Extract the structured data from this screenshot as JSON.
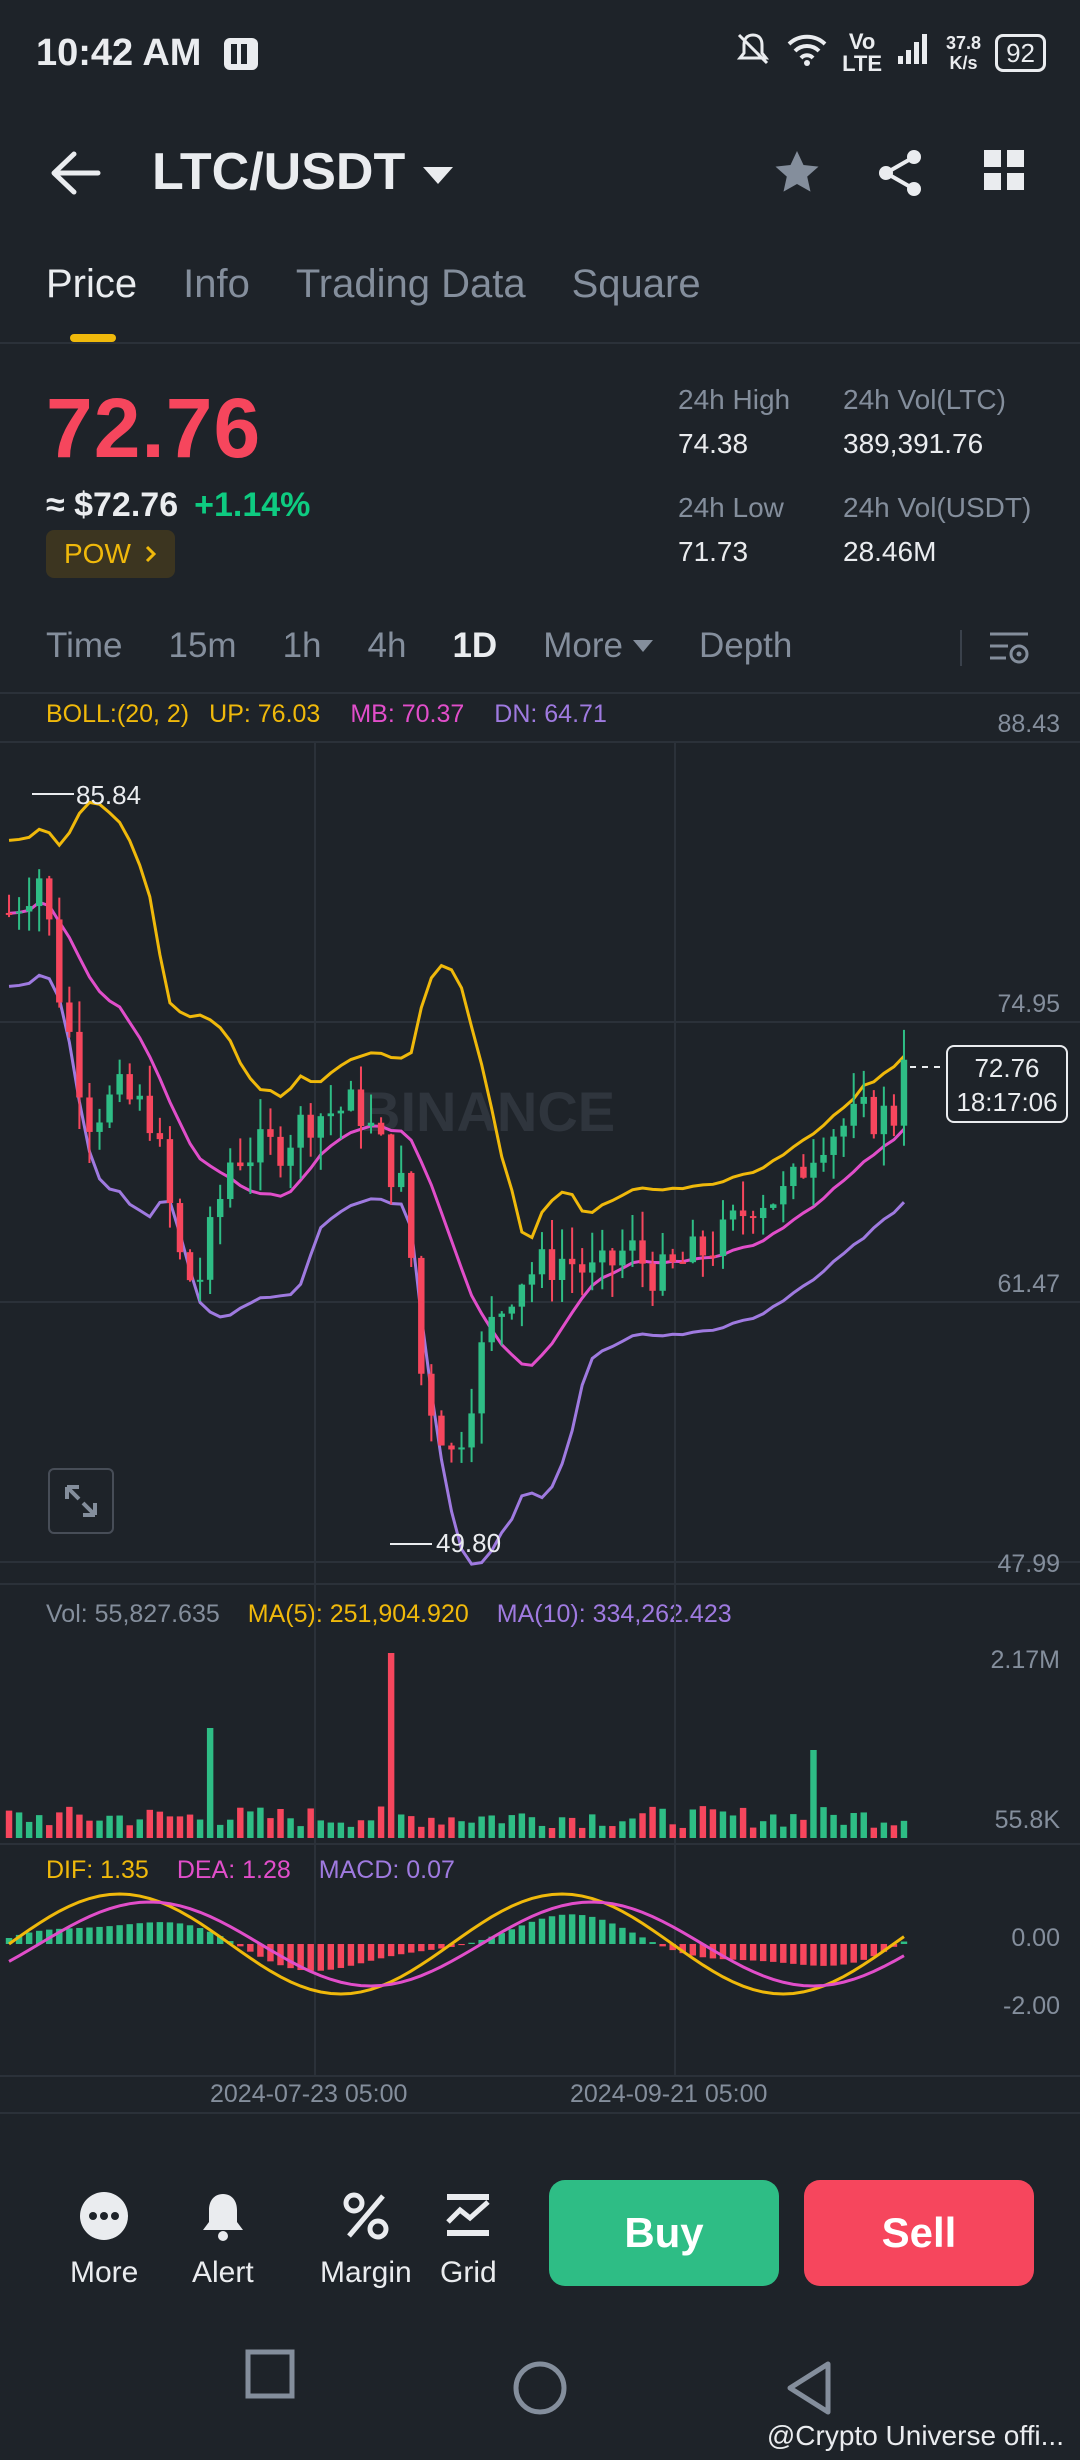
{
  "status_bar": {
    "time": "10:42 AM",
    "lte": "Vo\nLTE",
    "speed_top": "37.8",
    "speed_bottom": "K/s",
    "battery": "92"
  },
  "header": {
    "pair": "LTC/USDT"
  },
  "tabs": [
    {
      "label": "Price"
    },
    {
      "label": "Info"
    },
    {
      "label": "Trading Data"
    },
    {
      "label": "Square"
    }
  ],
  "ticker": {
    "price": "72.76",
    "usd_price": "≈ $72.76",
    "change_pct": "+1.14%",
    "tag": "POW",
    "high_label": "24h High",
    "high": "74.38",
    "low_label": "24h Low",
    "low": "71.73",
    "vol_ltc_label": "24h Vol(LTC)",
    "vol_ltc": "389,391.76",
    "vol_usdt_label": "24h Vol(USDT)",
    "vol_usdt": "28.46M"
  },
  "intervals": [
    {
      "label": "Time"
    },
    {
      "label": "15m"
    },
    {
      "label": "1h"
    },
    {
      "label": "4h"
    },
    {
      "label": "1D"
    },
    {
      "label": "More"
    },
    {
      "label": "Depth"
    }
  ],
  "indicators": {
    "boll": "BOLL:(20, 2)",
    "up": "UP: 76.03",
    "mb": "MB: 70.37",
    "dn": "DN: 64.71",
    "vol": "Vol: 55,827.635",
    "ma5": "MA(5): 251,904.920",
    "ma10": "MA(10): 334,262.423",
    "dif": "DIF: 1.35",
    "dea": "DEA: 1.28",
    "macd": "MACD: 0.07"
  },
  "chart_data": {
    "type": "candlestick",
    "price_axis_ticks": [
      "88.43",
      "74.95",
      "61.47",
      "47.99"
    ],
    "volume_axis_ticks": [
      "2.17M",
      "55.8K"
    ],
    "macd_axis_ticks": [
      "0.00",
      "-2.00"
    ],
    "x_tick_labels": [
      "2024-07-23 05:00",
      "2024-09-21 05:00"
    ],
    "high_marker": "85.84",
    "low_marker": "49.80",
    "last_price": "72.76",
    "countdown": "18:17:06",
    "watermark": "BINANCE",
    "price_range": [
      47.99,
      88.43
    ],
    "colors": {
      "up": "#2ebd85",
      "down": "#f6465d",
      "boll_up": "#f0b90b",
      "boll_mb": "#e14eca",
      "boll_dn": "#9f7ae0"
    }
  },
  "actions": [
    {
      "label": "More"
    },
    {
      "label": "Alert"
    },
    {
      "label": "Margin"
    },
    {
      "label": "Grid"
    }
  ],
  "buttons": {
    "buy": "Buy",
    "sell": "Sell"
  },
  "watermark": "@Crypto Universe offi..."
}
